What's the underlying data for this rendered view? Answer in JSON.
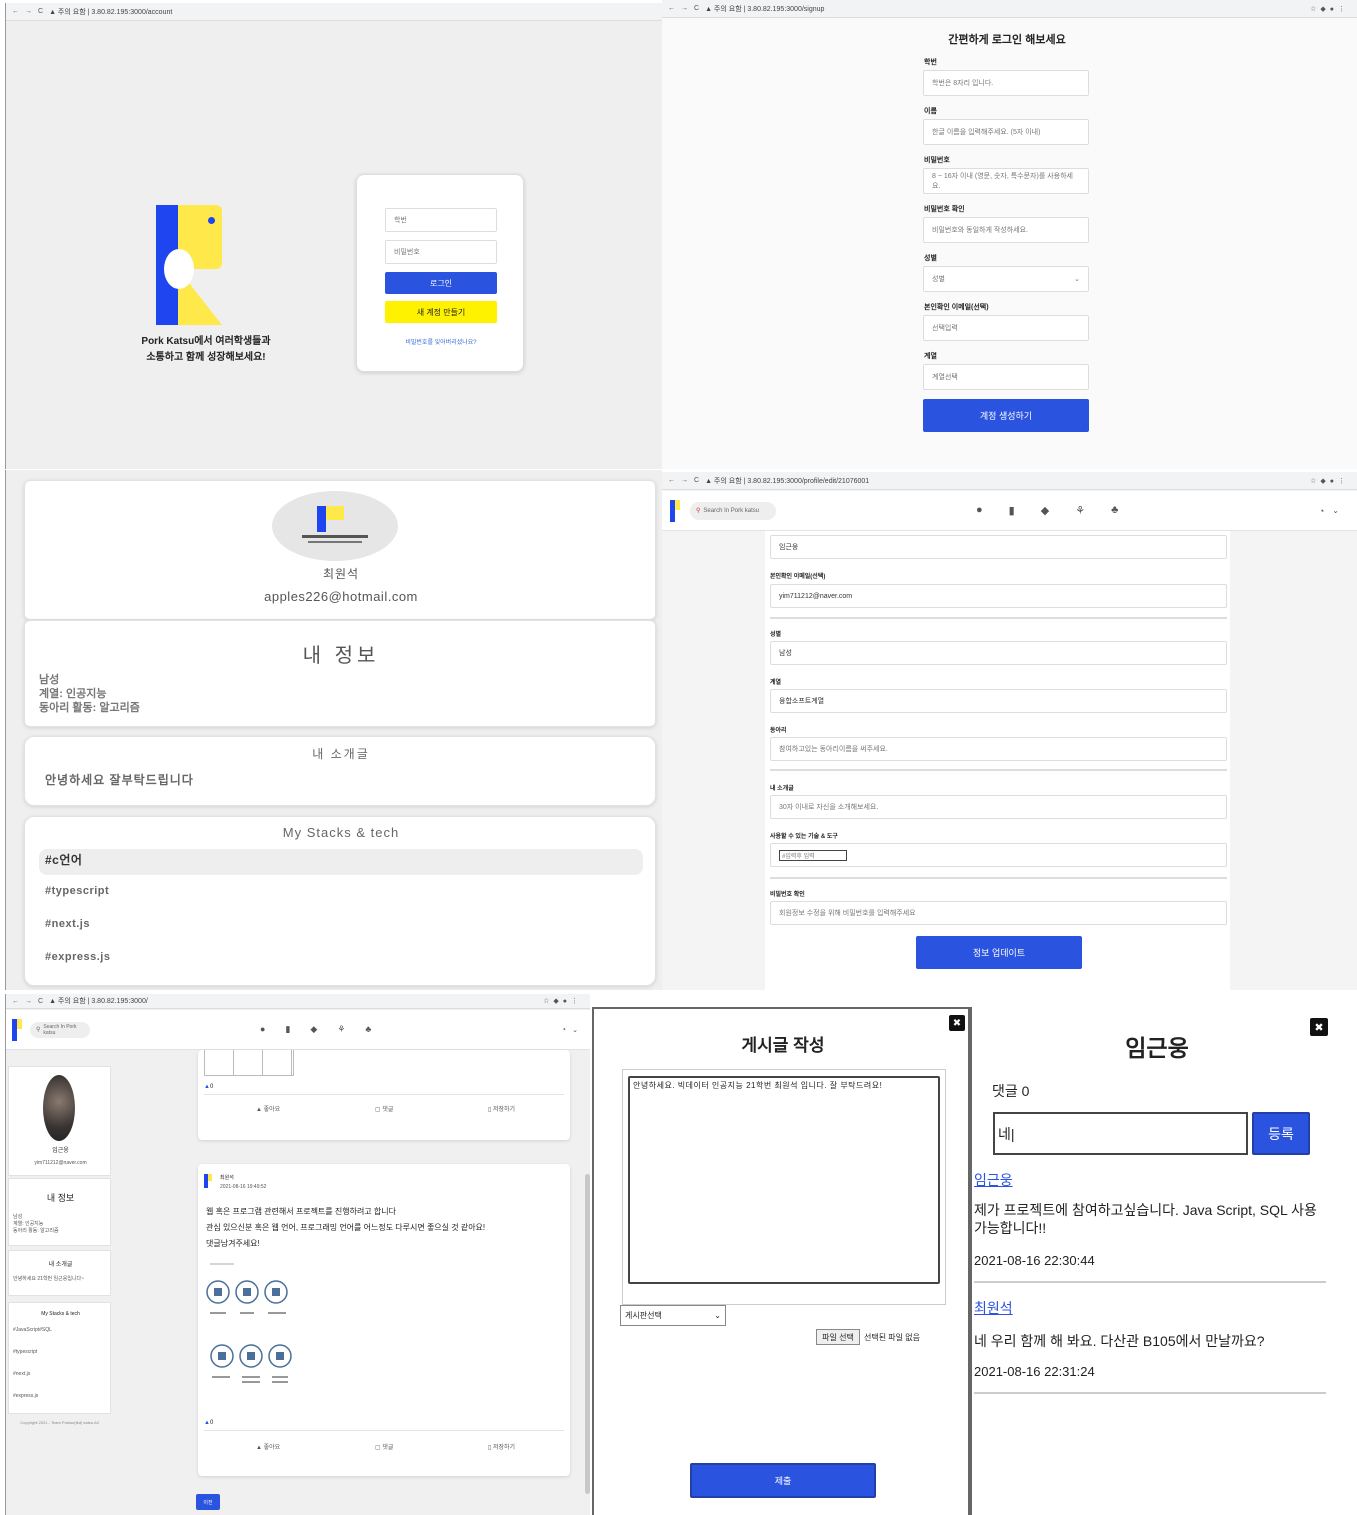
{
  "login": {
    "url": "▲ 주의 요함 | 3.80.82.195:3000/account",
    "tagline_1": "Pork Katsu에서 여러학생들과",
    "tagline_2": "소통하고 함께 성장해보세요!",
    "id_placeholder": "학번",
    "pw_placeholder": "비밀번호",
    "login_button": "로그인",
    "signup_button": "새 계정 만들기",
    "forgot_link": "비밀번호를 잊어버리셨나요?"
  },
  "signup": {
    "url": "▲ 주의 요함 | 3.80.82.195:3000/signup",
    "title": "간편하게 로그인 해보세요",
    "fields": [
      {
        "label": "학번",
        "placeholder": "학번은 8자리 입니다."
      },
      {
        "label": "이름",
        "placeholder": "한글 이름을 입력해주세요. (5자 이내)"
      },
      {
        "label": "비밀번호",
        "placeholder": "8 ~ 16자 이내 (영문, 숫자, 특수문자)를 사용하세요."
      },
      {
        "label": "비밀번호 확인",
        "placeholder": "비밀번호와 동일하게 작성하세요."
      },
      {
        "label": "성별",
        "placeholder": "성별"
      },
      {
        "label": "본인확인 이메일(선택)",
        "placeholder": "선택입력"
      },
      {
        "label": "계열",
        "placeholder": "계열선택"
      }
    ],
    "submit": "계정 생성하기"
  },
  "profile": {
    "name": "최원석",
    "email": "apples226@hotmail.com",
    "info_title": "내 정보",
    "gender": "남성",
    "dept": "계열: 인공지능",
    "club": "동아리 활동: 알고리즘",
    "intro_title": "내 소개글",
    "intro_text": "안녕하세요 잘부탁드립니다",
    "stacks_title": "My Stacks & tech",
    "stacks": [
      "#c언어",
      "#typescript",
      "#next.js",
      "#express.js"
    ]
  },
  "edit": {
    "url": "▲ 주의 요함 | 3.80.82.195:3000/profile/edit/21076001",
    "search_placeholder": "Search In Pork katsu",
    "name_value": "임근웅",
    "fields": [
      {
        "label": "본인확인 이메일(선택)",
        "value": "yim711212@naver.com"
      },
      {
        "label": "성별",
        "value": "남성"
      },
      {
        "label": "계열",
        "value": "융합소프트계열"
      },
      {
        "label": "동아리",
        "value": "참여하고있는 동아리이름을 써주세요."
      },
      {
        "label": "내 소개글",
        "value": "30자 이내로 자신을 소개해보세요."
      },
      {
        "label": "사용할 수 있는 기술 & 도구",
        "value": "#입력후 입력"
      },
      {
        "label": "비밀번호 확인",
        "value": "회원정보 수정을 위해 비밀번호를 입력해주세요"
      }
    ],
    "submit": "정보 업데이트"
  },
  "feed": {
    "url": "▲ 주의 요함 | 3.80.82.195:3000/",
    "search_placeholder": "Search In Pork katsu",
    "sidebar_name": "임근웅",
    "sidebar_email": "yim711212@naver.com",
    "info_title": "내 정보",
    "info_lines": [
      "남성",
      "계열: 인공지능",
      "동아리 활동: 알고리즘"
    ],
    "intro_title": "내 소개글",
    "intro_text": "안녕하세요 21학번 임근웅입니다~",
    "stacks_title": "My Stacks & tech",
    "stacks": [
      "#JavaScript#SQL",
      "#typescript",
      "#next.js",
      "#express.js"
    ],
    "copyright": "Copyright 2021 - Team Porksu(tkd) katsu.All",
    "actions": [
      "좋아요",
      "댓글",
      "저장하기"
    ],
    "post_author": "최원석",
    "post_date": "2021-08-16 19:49:52",
    "post_line1": "웹 혹은 프로그램 관련해서 프로젝트를 진행하려고 합니다",
    "post_line2": "관심 있으신분 혹은 웹 언어, 프로그래밍 언어를 어느정도 다루시면 좋으실 것 같아요!",
    "post_line3": "댓글남겨주세요!",
    "like_count": "0",
    "page_button": "이전"
  },
  "write": {
    "title": "게시글 작성",
    "content": "안녕하세요. 빅데이터 인공지능 21학번 최원석 입니다. 잘 부탁드려요!",
    "board_select": "게시판선택",
    "file_button": "파일 선택",
    "file_status": "선택된 파일 없음",
    "submit": "제출",
    "close": "✖"
  },
  "comments": {
    "title": "임근웅",
    "count_label": "댓글 0",
    "input_value": "네|",
    "submit": "등록",
    "close": "✖",
    "items": [
      {
        "author": "임근웅",
        "text": "제가 프로젝트에 참여하고싶습니다. Java Script, SQL 사용 가능합니다!!",
        "time": "2021-08-16 22:30:44"
      },
      {
        "author": "최원석",
        "text": "네 우리 함께 해 봐요. 다산관 B105에서 만날까요?",
        "time": "2021-08-16 22:31:24"
      }
    ]
  },
  "colors": {
    "blue": "#2a53e0",
    "yellow": "#fff200",
    "logo_blue": "#1f45f0",
    "logo_yellow": "#ffe84a"
  }
}
